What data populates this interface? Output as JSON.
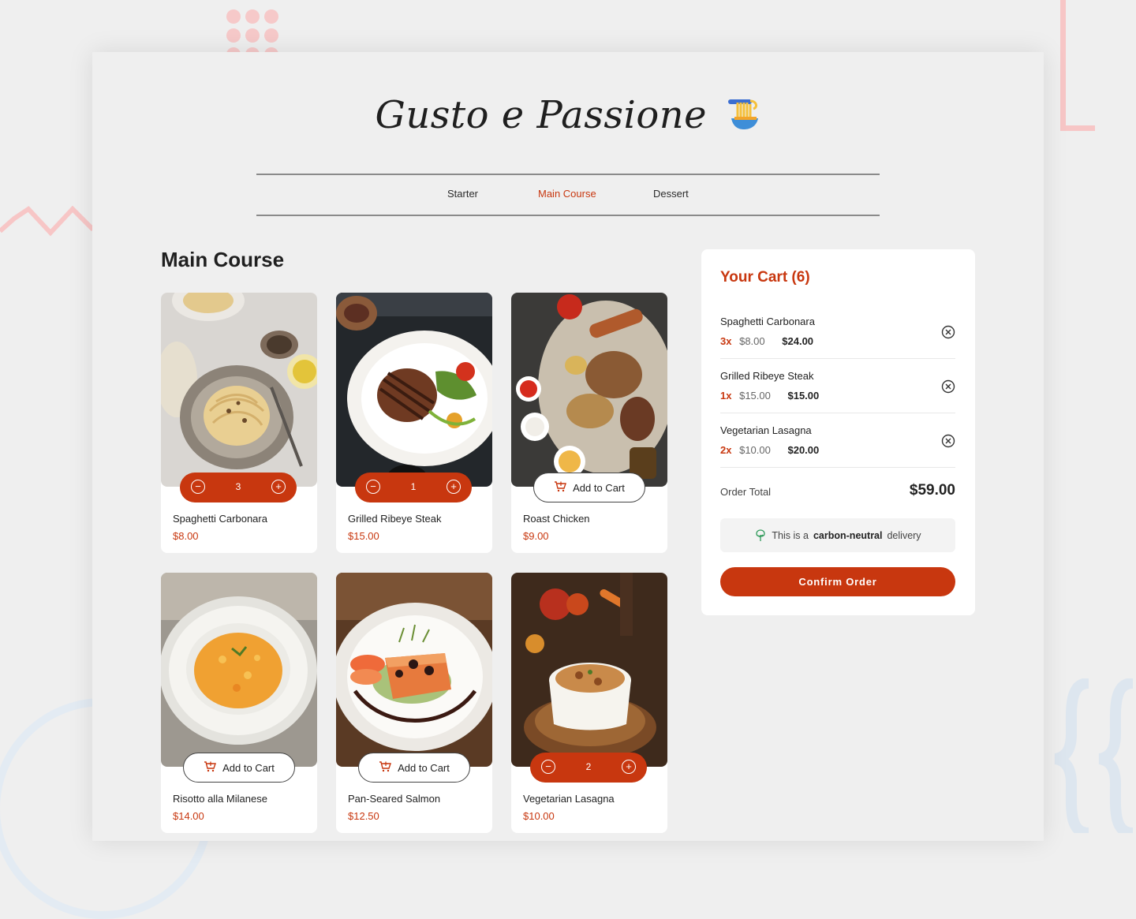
{
  "brand": {
    "title": "Gusto e Passione"
  },
  "nav": {
    "items": [
      {
        "label": "Starter"
      },
      {
        "label": "Main Course"
      },
      {
        "label": "Dessert"
      }
    ],
    "active": "Main Course"
  },
  "section": {
    "title": "Main Course"
  },
  "products": [
    {
      "name": "Spaghetti Carbonara",
      "price": "$8.00",
      "quantity": "3",
      "image": "spaghetti-carbonara-photo"
    },
    {
      "name": "Grilled Ribeye Steak",
      "price": "$15.00",
      "quantity": "1",
      "image": "ribeye-steak-photo"
    },
    {
      "name": "Roast Chicken",
      "price": "$9.00",
      "add_label": "Add to Cart",
      "image": "roast-chicken-photo"
    },
    {
      "name": "Risotto alla Milanese",
      "price": "$14.00",
      "add_label": "Add to Cart",
      "image": "risotto-photo"
    },
    {
      "name": "Pan-Seared Salmon",
      "price": "$12.50",
      "add_label": "Add to Cart",
      "image": "salmon-photo"
    },
    {
      "name": "Vegetarian Lasagna",
      "price": "$10.00",
      "quantity": "2",
      "image": "lasagna-photo"
    }
  ],
  "cart": {
    "title": "Your Cart (6)",
    "items": [
      {
        "name": "Spaghetti Carbonara",
        "qty": "3x",
        "unit": "$8.00",
        "total": "$24.00"
      },
      {
        "name": "Grilled Ribeye Steak",
        "qty": "1x",
        "unit": "$15.00",
        "total": "$15.00"
      },
      {
        "name": "Vegetarian Lasagna",
        "qty": "2x",
        "unit": "$10.00",
        "total": "$20.00"
      }
    ],
    "order_total_label": "Order Total",
    "order_total_value": "$59.00",
    "eco_prefix": "This is a",
    "eco_bold": "carbon-neutral",
    "eco_suffix": "delivery",
    "confirm_label": "Confirm Order"
  },
  "colors": {
    "accent": "#c8370f",
    "background": "#efefef",
    "card": "#ffffff"
  },
  "icons": [
    "noodle-bowl-icon",
    "minus-icon",
    "plus-icon",
    "cart-add-icon",
    "remove-circle-icon",
    "tree-icon"
  ]
}
